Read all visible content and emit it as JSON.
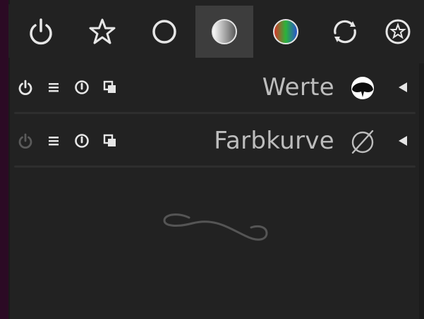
{
  "tabbar": {
    "tabs": [
      {
        "name": "active-modules",
        "icon": "power-icon"
      },
      {
        "name": "favorites",
        "icon": "star-icon"
      },
      {
        "name": "basic",
        "icon": "circle-icon"
      },
      {
        "name": "tone",
        "icon": "gradient-sphere-icon",
        "active": true
      },
      {
        "name": "color",
        "icon": "color-sphere-icon"
      },
      {
        "name": "correct",
        "icon": "rotate-arrows-icon"
      },
      {
        "name": "effect",
        "icon": "star-circle-icon"
      }
    ]
  },
  "modules": [
    {
      "title": "Werte",
      "icon": "levels-icon",
      "enabled": true
    },
    {
      "title": "Farbkurve",
      "icon": "no-curve-icon",
      "enabled": false
    }
  ],
  "colors": {
    "background": "#222222",
    "active_tab": "#3d3d3d",
    "text": "#bdbdbd",
    "outer": "#2b0a24"
  }
}
